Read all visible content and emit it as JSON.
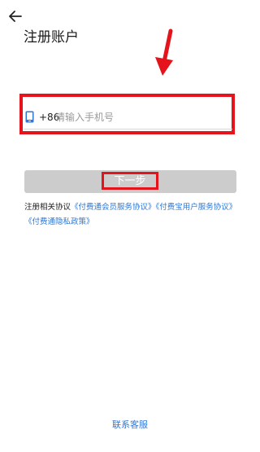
{
  "header": {
    "back_icon": "arrow-left-icon",
    "title": "注册账户"
  },
  "annotation": {
    "highlight_color": "#e5131b",
    "pointer_icon": "red-arrow-down-icon"
  },
  "phone_field": {
    "icon": "smartphone-icon",
    "country_code": "+86",
    "value": "",
    "placeholder": "请输入手机号"
  },
  "next_button": {
    "label": "下一步",
    "background": "#cccccc"
  },
  "agreement": {
    "prefix": "注册相关协议",
    "links": [
      "《付费通会员服务协议》",
      "《付费宝用户服务协议》",
      "《付费通隐私政策》"
    ],
    "link_color": "#2f78d4"
  },
  "footer": {
    "contact_label": "联系客服"
  }
}
